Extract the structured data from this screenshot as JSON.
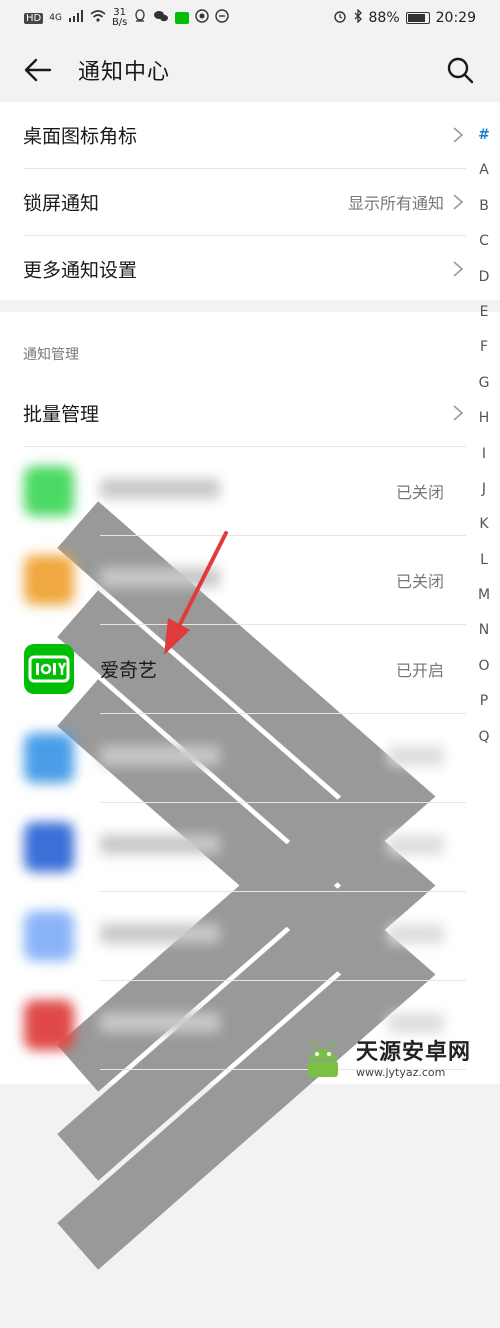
{
  "status_bar": {
    "left_badges": [
      "HD",
      "4G"
    ],
    "speed_top": "31",
    "speed_bottom": "B/s",
    "battery": "88%",
    "time": "20:29"
  },
  "app_bar": {
    "title": "通知中心",
    "back_icon": "arrow-left-icon",
    "search_icon": "search-icon"
  },
  "settings": [
    {
      "label": "桌面图标角标",
      "value": ""
    },
    {
      "label": "锁屏通知",
      "value": "显示所有通知"
    },
    {
      "label": "更多通知设置",
      "value": ""
    }
  ],
  "section_title": "通知管理",
  "batch_manage": {
    "label": "批量管理"
  },
  "apps": [
    {
      "name": "",
      "status": "已关闭",
      "blurred": true,
      "color": "#4cd964"
    },
    {
      "name": "",
      "status": "已关闭",
      "blurred": true,
      "color": "#f0a840"
    },
    {
      "name": "爱奇艺",
      "status": "已开启",
      "blurred": false,
      "color": "#00be06"
    },
    {
      "name": "",
      "status": "",
      "blurred": true,
      "color": "#4a9ee8"
    },
    {
      "name": "",
      "status": "",
      "blurred": true,
      "color": "#3c6fd8"
    },
    {
      "name": "",
      "status": "",
      "blurred": true,
      "color": "#8ab4f8"
    },
    {
      "name": "",
      "status": "",
      "blurred": true,
      "color": "#e04848"
    }
  ],
  "index_letters": [
    "#",
    "A",
    "B",
    "C",
    "D",
    "E",
    "F",
    "G",
    "H",
    "I",
    "J",
    "K",
    "L",
    "M",
    "N",
    "O",
    "P",
    "Q"
  ],
  "active_index": "#",
  "watermark": {
    "main": "天源安卓网",
    "sub": "www.jytyaz.com"
  }
}
